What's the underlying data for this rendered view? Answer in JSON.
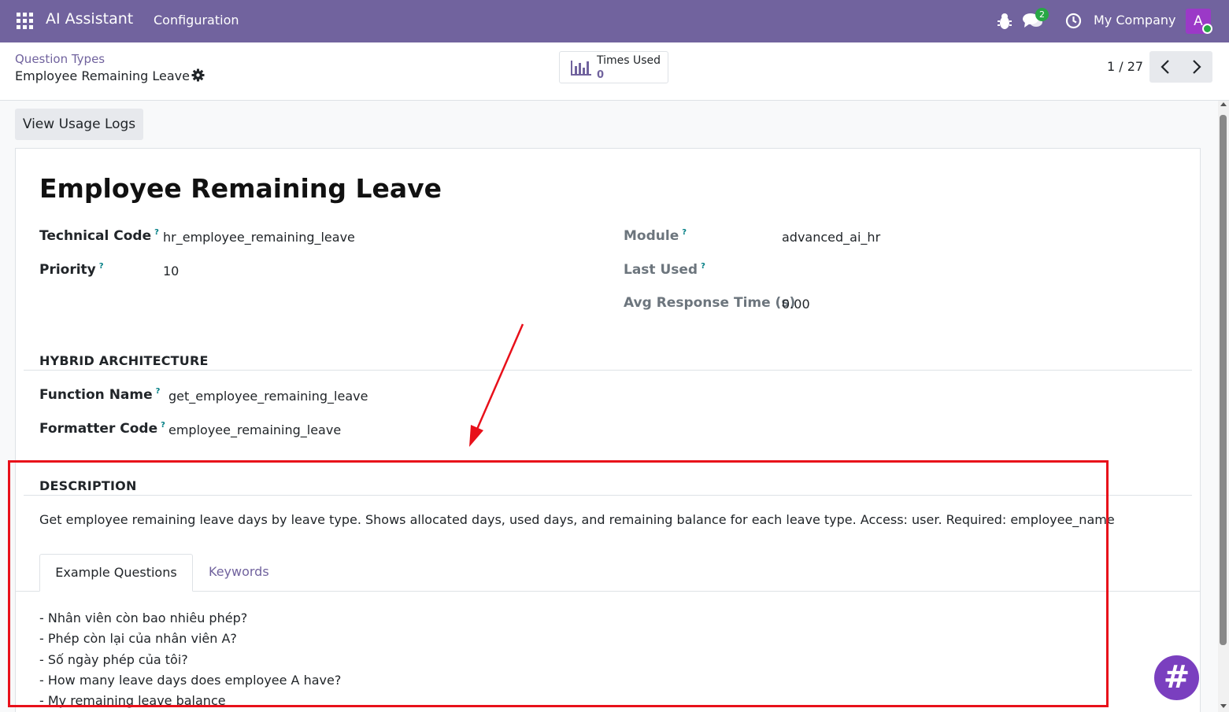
{
  "navbar": {
    "app_name": "AI Assistant",
    "menu_configuration": "Configuration",
    "chat_badge": "2",
    "company": "My Company",
    "avatar_initial": "A",
    "color": "#71639e"
  },
  "breadcrumb": {
    "parent": "Question Types",
    "current": "Employee Remaining Leave"
  },
  "stat_button": {
    "label": "Times Used",
    "value": "0"
  },
  "pager": {
    "value": "1 / 27"
  },
  "actions": {
    "view_usage_logs": "View Usage Logs"
  },
  "record": {
    "title": "Employee Remaining Leave",
    "fields_left": [
      {
        "label": "Technical Code",
        "value": "hr_employee_remaining_leave"
      },
      {
        "label": "Priority",
        "value": "10"
      }
    ],
    "fields_right": [
      {
        "label": "Module",
        "value": "advanced_ai_hr"
      },
      {
        "label": "Last Used",
        "value": ""
      },
      {
        "label": "Avg Response Time (s)",
        "value": "0.00"
      }
    ],
    "hybrid": {
      "heading": "HYBRID ARCHITECTURE",
      "fields": [
        {
          "label": "Function Name",
          "value": "get_employee_remaining_leave"
        },
        {
          "label": "Formatter Code",
          "value": "employee_remaining_leave"
        }
      ]
    },
    "description": {
      "heading": "DESCRIPTION",
      "text": "Get employee remaining leave days by leave type. Shows allocated days, used days, and remaining balance for each leave type. Access: user. Required: employee_name"
    },
    "tabs": [
      {
        "label": "Example Questions",
        "active": true
      },
      {
        "label": "Keywords",
        "active": false
      }
    ],
    "example_questions": [
      "- Nhân viên còn bao nhiêu phép?",
      "- Phép còn lại của nhân viên A?",
      "- Số ngày phép của tôi?",
      "- How many leave days does employee A have?",
      "- My remaining leave balance"
    ]
  },
  "fab": {
    "symbol": "#"
  },
  "annotation_color": "#e8101a"
}
